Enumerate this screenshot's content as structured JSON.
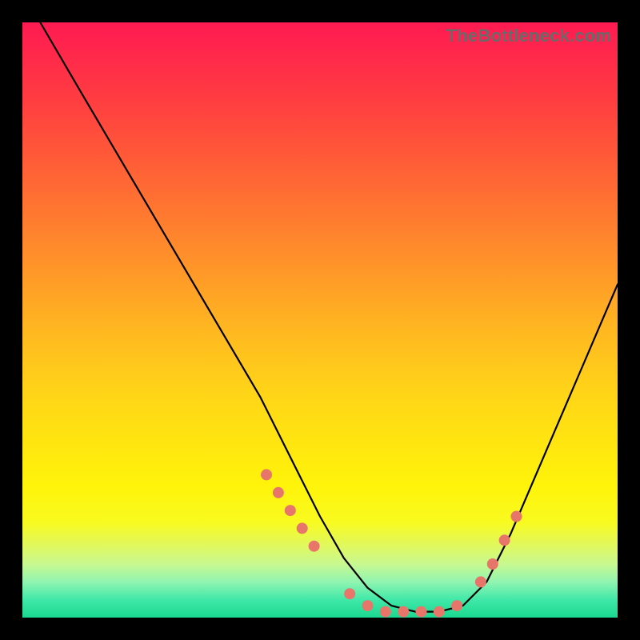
{
  "watermark": "TheBottleneck.com",
  "chart_data": {
    "type": "line",
    "title": "",
    "xlabel": "",
    "ylabel": "",
    "xlim": [
      0,
      100
    ],
    "ylim": [
      0,
      100
    ],
    "series": [
      {
        "name": "curve",
        "x": [
          3,
          10,
          20,
          30,
          40,
          46,
          50,
          54,
          58,
          62,
          66,
          70,
          74,
          78,
          82,
          88,
          94,
          100
        ],
        "y": [
          100,
          88,
          71,
          54,
          37,
          25,
          17,
          10,
          5,
          2,
          1,
          1,
          2,
          6,
          14,
          28,
          42,
          56
        ]
      }
    ],
    "highlight_dots": {
      "name": "dots",
      "x": [
        41,
        43,
        45,
        47,
        49,
        55,
        58,
        61,
        64,
        67,
        70,
        73,
        77,
        79,
        81,
        83
      ],
      "y": [
        24,
        21,
        18,
        15,
        12,
        4,
        2,
        1,
        1,
        1,
        1,
        2,
        6,
        9,
        13,
        17
      ]
    },
    "gradient_stops": [
      {
        "pos": 0,
        "color": "#ff1a52"
      },
      {
        "pos": 50,
        "color": "#ffb820"
      },
      {
        "pos": 80,
        "color": "#fff40a"
      },
      {
        "pos": 100,
        "color": "#1ad890"
      }
    ]
  }
}
